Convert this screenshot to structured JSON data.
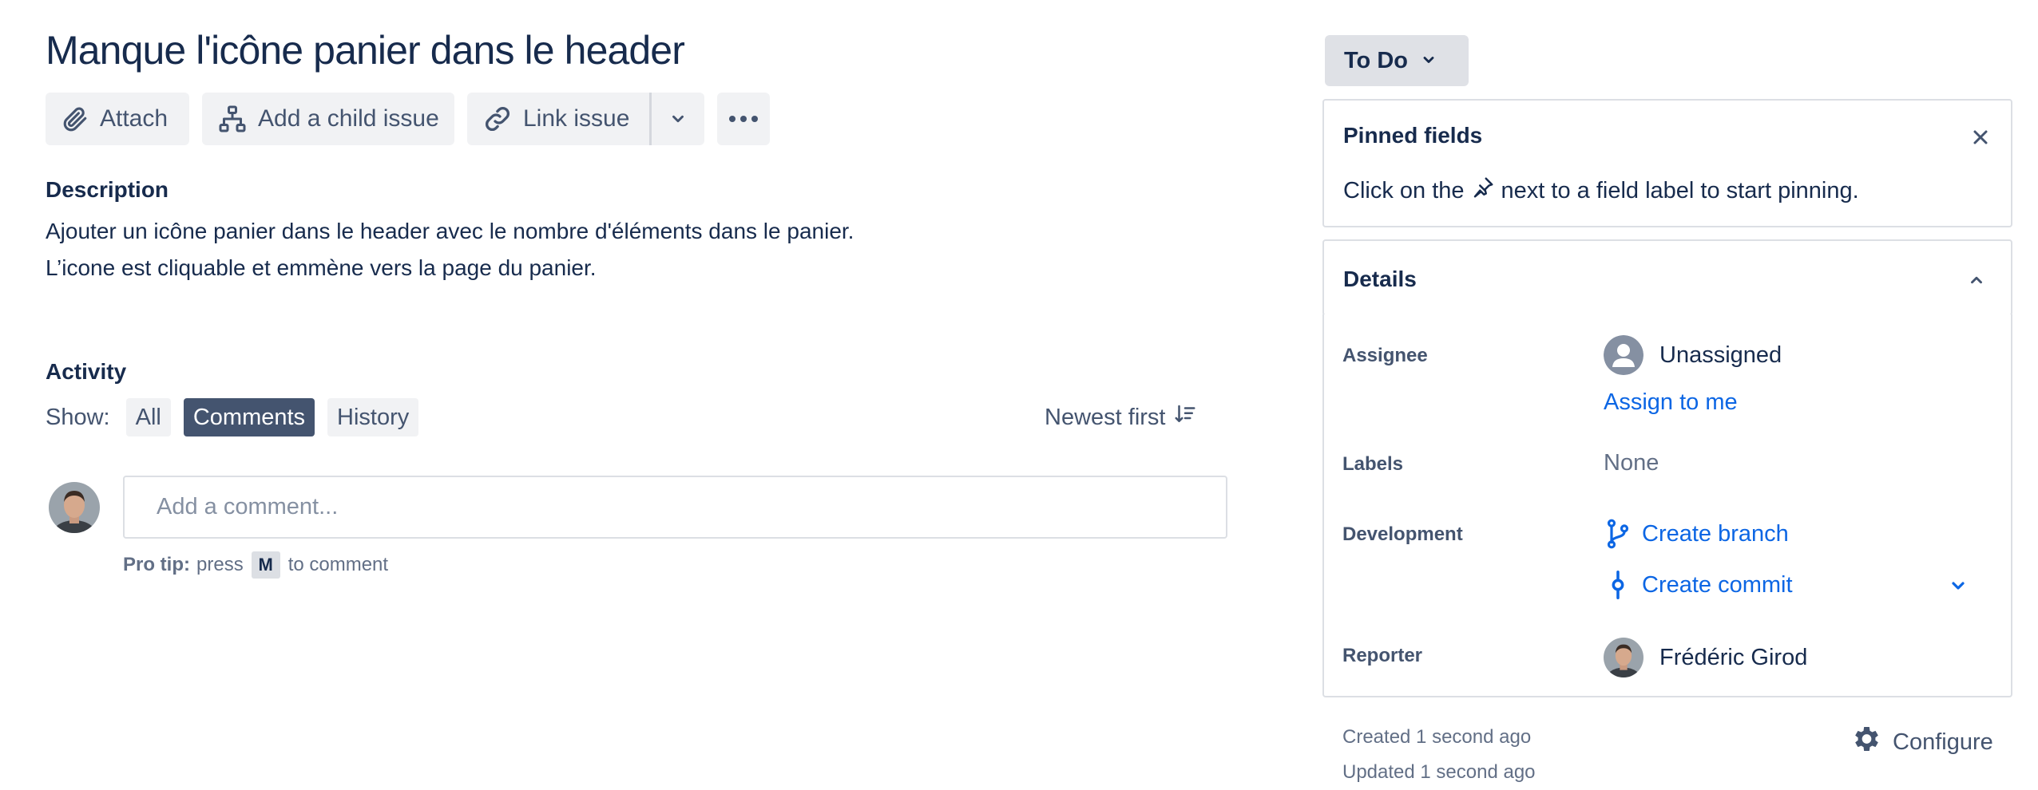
{
  "issue": {
    "title": "Manque l'icône panier dans le header"
  },
  "toolbar": {
    "attach_label": "Attach",
    "add_child_label": "Add a child issue",
    "link_issue_label": "Link issue"
  },
  "description": {
    "heading": "Description",
    "lines": [
      "Ajouter un icône panier dans le header avec le nombre d'éléments dans le panier.",
      "L’icone est cliquable et emmène vers la page du panier."
    ]
  },
  "activity": {
    "heading": "Activity",
    "show_label": "Show:",
    "filters": [
      {
        "label": "All",
        "active": false
      },
      {
        "label": "Comments",
        "active": true
      },
      {
        "label": "History",
        "active": false
      }
    ],
    "sort_label": "Newest first",
    "comment_placeholder": "Add a comment...",
    "protip_bold": "Pro tip:",
    "protip_before": "press",
    "protip_key": "M",
    "protip_after": "to comment"
  },
  "status": {
    "label": "To Do"
  },
  "pinned": {
    "title": "Pinned fields",
    "hint_before": "Click on the",
    "hint_after": "next to a field label to start pinning."
  },
  "details": {
    "title": "Details",
    "assignee_label": "Assignee",
    "assignee_value": "Unassigned",
    "assign_to_me": "Assign to me",
    "labels_label": "Labels",
    "labels_value": "None",
    "development_label": "Development",
    "create_branch": "Create branch",
    "create_commit": "Create commit",
    "reporter_label": "Reporter",
    "reporter_value": "Frédéric Girod"
  },
  "meta": {
    "created": "Created 1 second ago",
    "updated": "Updated 1 second ago",
    "configure_label": "Configure"
  },
  "colors": {
    "text": "#172b4d",
    "subtle": "#44546f",
    "link": "#0c66e4",
    "active_pill": "#44546f",
    "button_bg": "#f1f2f4",
    "border": "#dcdfe4"
  }
}
